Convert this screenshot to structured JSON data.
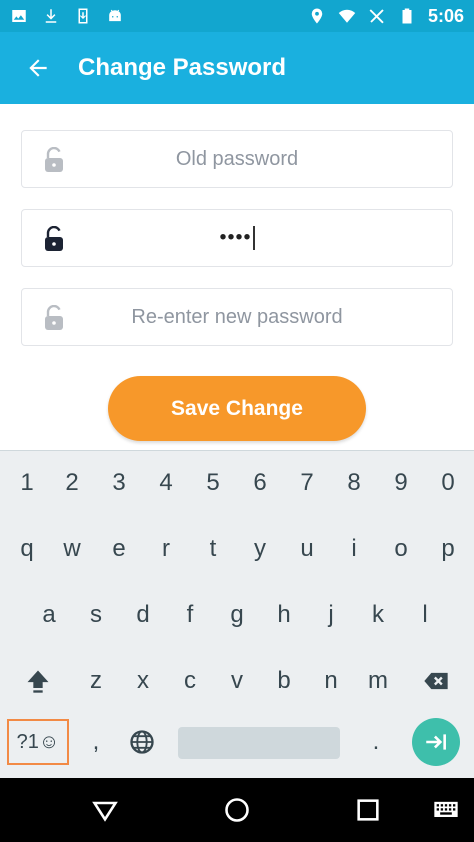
{
  "status_bar": {
    "time": "5:06",
    "left_icons": [
      "image-icon",
      "download-icon",
      "phone-download-icon",
      "android-icon"
    ],
    "right_icons": [
      "location-icon",
      "wifi-icon",
      "no-sim-icon",
      "battery-icon"
    ]
  },
  "app_bar": {
    "title": "Change Password",
    "back_icon": "arrow-back-icon"
  },
  "form": {
    "old_password": {
      "placeholder": "Old password",
      "value": ""
    },
    "new_password": {
      "placeholder": "",
      "value": "••••"
    },
    "reenter_password": {
      "placeholder": "Re-enter new password",
      "value": ""
    }
  },
  "save_button": {
    "label": "Save Change"
  },
  "keyboard": {
    "row1": [
      "1",
      "2",
      "3",
      "4",
      "5",
      "6",
      "7",
      "8",
      "9",
      "0"
    ],
    "row2": [
      "q",
      "w",
      "e",
      "r",
      "t",
      "y",
      "u",
      "i",
      "o",
      "p"
    ],
    "row3": [
      "a",
      "s",
      "d",
      "f",
      "g",
      "h",
      "j",
      "k",
      "l"
    ],
    "row4": [
      "z",
      "x",
      "c",
      "v",
      "b",
      "n",
      "m"
    ],
    "symbols_label": "?1☺",
    "comma": ",",
    "period": "."
  },
  "colors": {
    "status_bar": "#12a6cf",
    "app_bar": "#1ab0df",
    "accent": "#f7982a",
    "enter": "#3ebfab"
  }
}
